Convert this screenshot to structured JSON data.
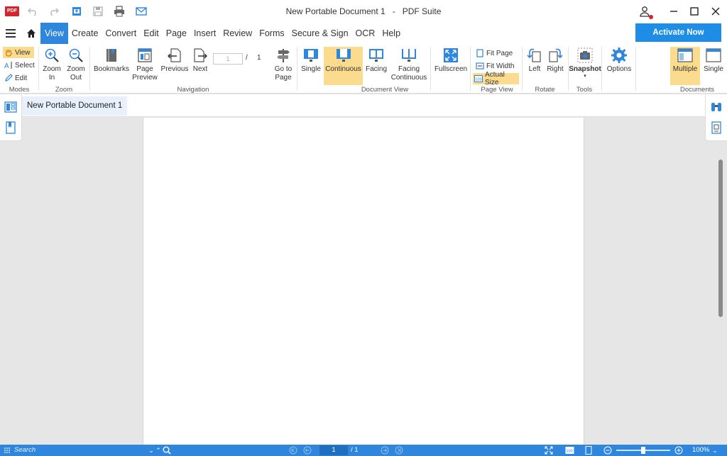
{
  "titlebar": {
    "logo": "PDF",
    "document_title": "New Portable Document 1",
    "separator": "-",
    "app_name": "PDF Suite"
  },
  "menu": {
    "tabs": [
      "View",
      "Create",
      "Convert",
      "Edit",
      "Page",
      "Insert",
      "Review",
      "Forms",
      "Secure & Sign",
      "OCR",
      "Help"
    ],
    "active_tab": "View",
    "activate_label": "Activate Now"
  },
  "ribbon": {
    "modes": {
      "view": "View",
      "select": "Select",
      "edit": "Edit",
      "label": "Modes"
    },
    "zoom": {
      "zoom_in": [
        "Zoom",
        "In"
      ],
      "zoom_out": [
        "Zoom",
        "Out"
      ],
      "label": "Zoom"
    },
    "navigation": {
      "bookmarks": "Bookmarks",
      "page_preview": [
        "Page",
        "Preview"
      ],
      "previous": "Previous",
      "next": "Next",
      "page_value": "1",
      "slash": "/",
      "page_total": "1",
      "label": "Navigation"
    },
    "goto": [
      "Go to",
      "Page"
    ],
    "document_view": {
      "single": "Single",
      "continuous": "Continuous",
      "facing": "Facing",
      "facing_continuous": [
        "Facing",
        "Continuous"
      ],
      "label": "Document View"
    },
    "fullscreen": "Fullscreen",
    "page_view": {
      "fit_page": "Fit Page",
      "fit_width": "Fit Width",
      "actual_size": "Actual Size",
      "label": "Page View"
    },
    "rotate": {
      "left": "Left",
      "right": "Right",
      "label": "Rotate"
    },
    "tools": {
      "snapshot": "Snapshot",
      "label": "Tools"
    },
    "options": "Options",
    "documents": {
      "multiple": "Multiple",
      "single": "Single",
      "label": "Documents"
    }
  },
  "doc_tabs": [
    "New Portable Document 1"
  ],
  "statusbar": {
    "search_placeholder": "Search",
    "page_value": "1",
    "page_total": "/ 1",
    "zoom_percent": "100%",
    "zoom_level": 0.5
  },
  "colors": {
    "accent": "#2f86dd",
    "activate": "#1e8de6",
    "highlight": "#fbdc8e",
    "logo_red": "#d8232a"
  }
}
